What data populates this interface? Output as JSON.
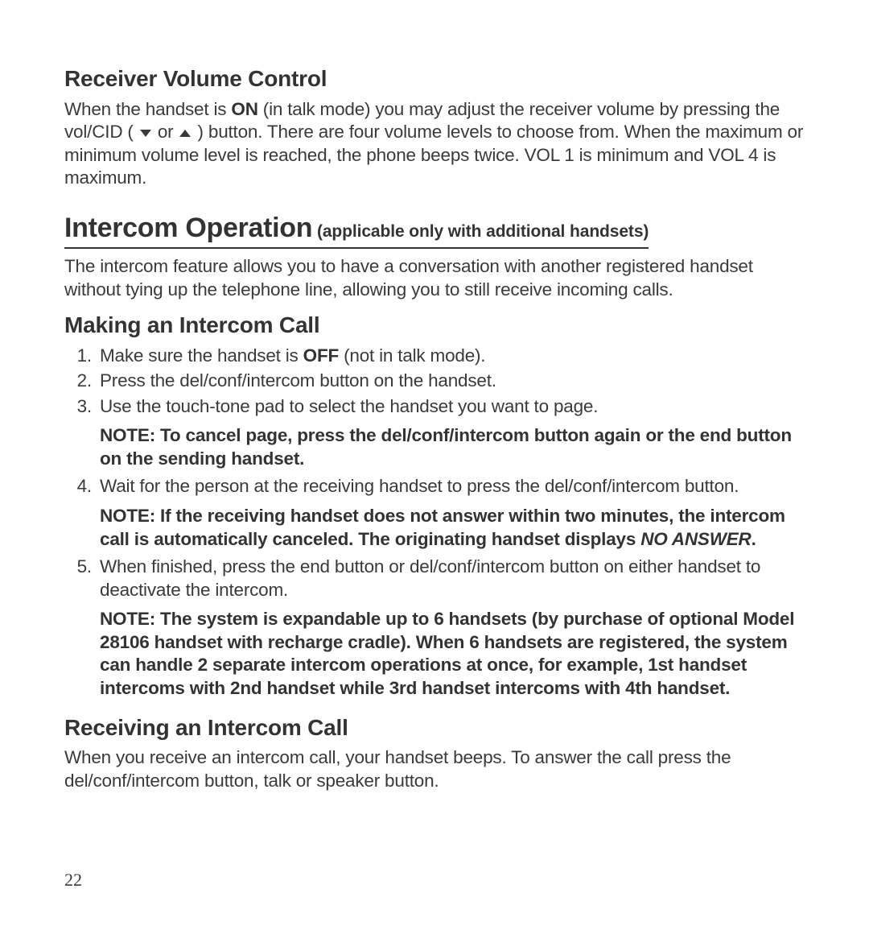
{
  "section1": {
    "heading": "Receiver Volume Control",
    "p_a": "When the handset is ",
    "p_on": "ON",
    "p_b": " (in talk mode) you may adjust the receiver volume by pressing the vol/CID ( ",
    "p_c": " or ",
    "p_d": " ) button. There are four volume levels to choose from. When the maximum or minimum volume level is reached, the phone beeps twice. VOL 1 is minimum and VOL 4 is maximum."
  },
  "section2": {
    "heading": "Intercom Operation",
    "subheading": " (applicable only with additional handsets)",
    "p": "The intercom feature allows you to have a conversation with another registered handset without tying up the telephone line, allowing you to still receive incoming calls."
  },
  "section3": {
    "heading": "Making an Intercom Call",
    "li1_a": "Make sure the handset is ",
    "li1_off": "OFF",
    "li1_b": " (not in talk mode).",
    "li2": "Press the del/conf/intercom button on the handset.",
    "li3": "Use the touch-tone pad to select the handset you want to page.",
    "note3": "NOTE: To cancel page, press the del/conf/intercom button again or the end button on the sending handset.",
    "li4": "Wait for the person at the receiving handset to press the del/conf/intercom button.",
    "note4_a": "NOTE: If the receiving handset does not answer within two minutes, the intercom call is automatically canceled. The originating handset displays ",
    "note4_b": "NO ANSWER",
    "note4_c": ".",
    "li5": "When finished, press the end button or del/conf/intercom button on either handset to deactivate the intercom.",
    "note5": "NOTE: The system is expandable up to 6 handsets (by purchase of optional Model 28106 handset with recharge cradle). When 6 handsets are registered, the system can handle 2 separate intercom operations at once, for example, 1st handset intercoms with 2nd handset while 3rd handset intercoms with 4th handset."
  },
  "section4": {
    "heading": "Receiving an Intercom Call",
    "p": "When you receive an intercom call, your handset beeps. To answer the call press the del/conf/intercom button, talk or speaker button."
  },
  "page_number": "22"
}
